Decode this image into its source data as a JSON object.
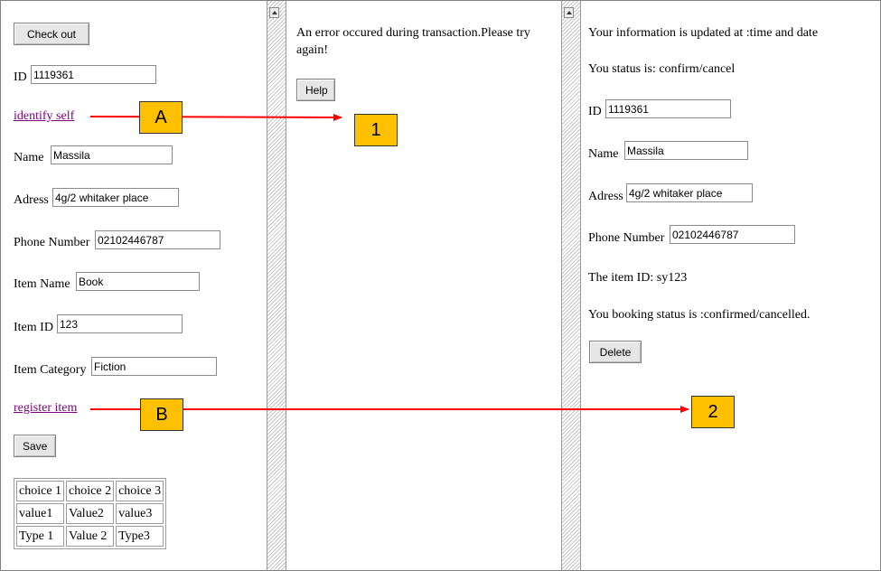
{
  "left_pane": {
    "checkout_button": "Check out",
    "id_label": "ID",
    "id_value": "1119361",
    "identify_link": "identify self",
    "name_label": "Name",
    "name_value": "Massila",
    "address_label": "Adress",
    "address_value": "4g/2 whitaker place",
    "phone_label": "Phone Number",
    "phone_value": "02102446787",
    "item_name_label": "Item Name",
    "item_name_value": "Book",
    "item_id_label": "Item ID",
    "item_id_value": "123",
    "item_category_label": "Item Category",
    "item_category_value": "Fiction",
    "register_link": "register item",
    "save_button": "Save",
    "table": [
      [
        "choice 1",
        "choice 2",
        "choice 3"
      ],
      [
        "value1",
        "Value2",
        "value3"
      ],
      [
        "Type 1",
        "Value 2",
        "Type3"
      ]
    ]
  },
  "middle_pane": {
    "error_line1": "An error occured during transaction.Please try",
    "error_line2": "again!",
    "help_button": "Help"
  },
  "right_pane": {
    "updated_text": "Your information is updated at :time and date",
    "status_text": "You status is: confirm/cancel",
    "id_label": "ID",
    "id_value": "1119361",
    "name_label": "Name",
    "name_value": "Massila",
    "address_label": "Adress",
    "address_value": "4g/2 whitaker place",
    "phone_label": "Phone Number",
    "phone_value": "02102446787",
    "item_id_text": "The item ID: sy123",
    "booking_status_text": "You booking status is :confirmed/cancelled.",
    "delete_button": "Delete"
  },
  "callouts": {
    "a": "A",
    "b": "B",
    "one": "1",
    "two": "2"
  },
  "colors": {
    "callout_fill": "#ffc000",
    "arrow": "#ff0000",
    "visited_link": "#800080"
  }
}
